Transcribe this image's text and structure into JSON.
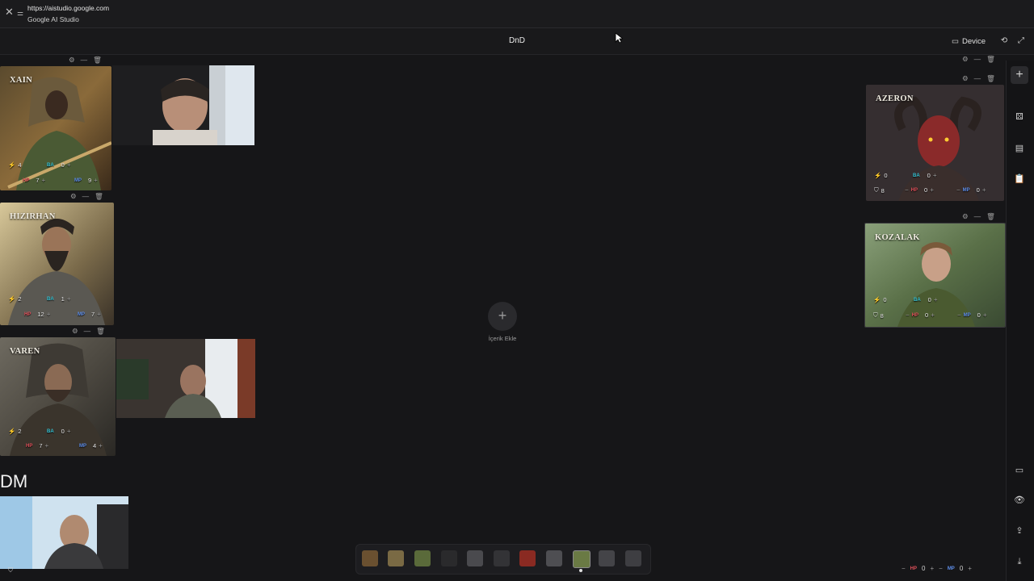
{
  "browser": {
    "url": "https://aistudio.google.com",
    "site_name": "Google AI Studio"
  },
  "app": {
    "title": "DnD",
    "device_label": "Device"
  },
  "characters": {
    "xain": {
      "name": "XAIN",
      "bolt": "4",
      "ba": "0",
      "hp": "7",
      "mp": "9"
    },
    "hizirhan": {
      "name": "HIZIRHAN",
      "bolt": "2",
      "ba": "1",
      "hp": "12",
      "mp": "7"
    },
    "varen": {
      "name": "VAREN",
      "bolt": "2",
      "ba": "0",
      "hp": "7",
      "mp": "4"
    },
    "azeron": {
      "name": "AZERON",
      "bolt": "0",
      "ba": "0",
      "hp": "0",
      "mp": "0",
      "shield": "8"
    },
    "kozalak": {
      "name": "KOZALAK",
      "bolt": "0",
      "ba": "0",
      "hp": "0",
      "mp": "0",
      "shield": "8"
    }
  },
  "labels": {
    "ba": "BA",
    "hp": "HP",
    "mp": "MP"
  },
  "center": {
    "add_content_label": "İçerik Ekle"
  },
  "dm": {
    "label": "DM"
  },
  "bottom_stats": {
    "hp": "0",
    "mp": "0"
  },
  "colors": {
    "background": "#161618",
    "ba": "#39c7d8",
    "hp": "#e0505a",
    "mp": "#5d8de8",
    "bolt": "#d6a21c"
  },
  "icons": [
    "close-icon",
    "site-info-icon",
    "device-icon",
    "refresh-icon",
    "fullscreen-icon",
    "settings-icon",
    "minimize-icon",
    "delete-icon",
    "plus-icon",
    "dice-icon",
    "book-icon",
    "clipboard-icon",
    "panel-icon",
    "eye-icon",
    "upload-icon",
    "download-icon"
  ]
}
